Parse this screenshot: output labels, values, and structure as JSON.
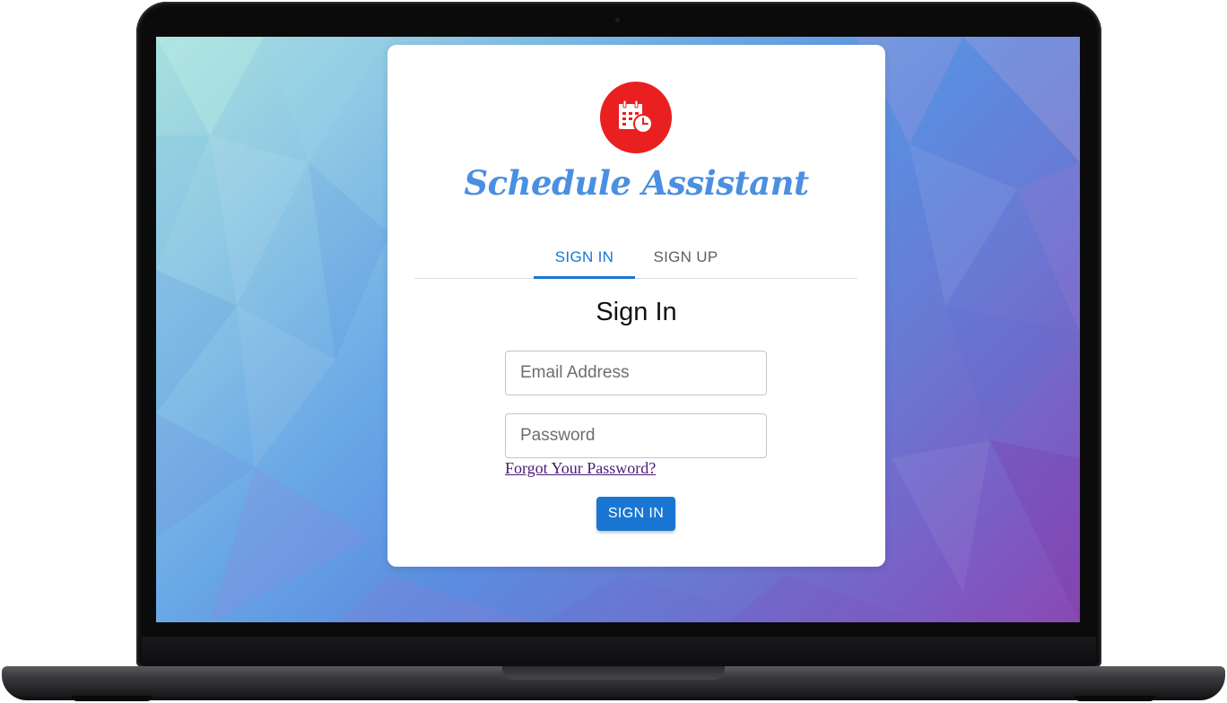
{
  "app": {
    "title": "Schedule Assistant",
    "logo_icon": "calendar-clock-icon",
    "accent_color": "#1976d2",
    "logo_color": "#ea1f1f"
  },
  "tabs": [
    {
      "label": "SIGN IN",
      "active": true
    },
    {
      "label": "SIGN UP",
      "active": false
    }
  ],
  "form": {
    "heading": "Sign In",
    "email_placeholder": "Email Address",
    "password_placeholder": "Password",
    "forgot_link": "Forgot Your Password?",
    "submit_label": "SIGN IN"
  }
}
